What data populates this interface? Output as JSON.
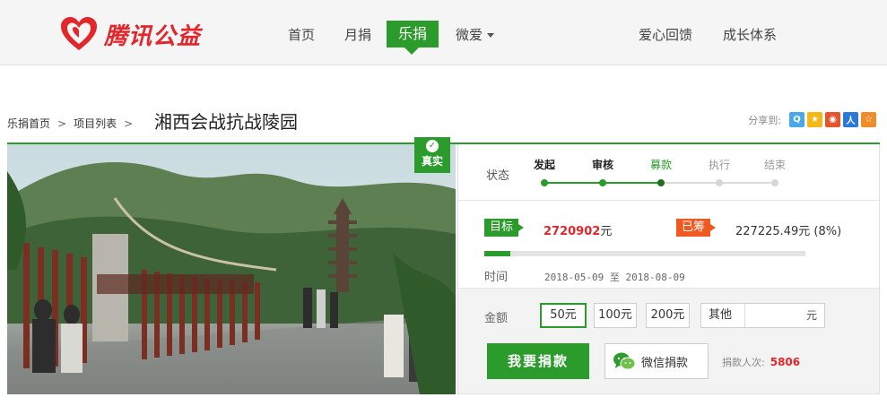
{
  "brand": {
    "name": "腾讯公益"
  },
  "nav": {
    "items": [
      "首页",
      "月捐",
      "乐捐",
      "微爱"
    ],
    "active": "乐捐",
    "right_items": [
      "爱心回馈",
      "成长体系"
    ]
  },
  "breadcrumb": [
    "乐捐首页",
    "项目列表"
  ],
  "breadcrumb_sep": ">",
  "project": {
    "title": "湘西会战抗战陵园"
  },
  "share": {
    "label": "分享到:",
    "icons": [
      "qzone-icon",
      "qq-star-icon",
      "weibo-icon",
      "renren-icon",
      "pengyou-icon"
    ]
  },
  "badge": {
    "label": "真实"
  },
  "status": {
    "label": "状态",
    "steps": [
      {
        "name": "发起",
        "state": "done"
      },
      {
        "name": "审核",
        "state": "done"
      },
      {
        "name": "募款",
        "state": "current"
      },
      {
        "name": "执行",
        "state": "todo"
      },
      {
        "name": "结束",
        "state": "todo"
      }
    ]
  },
  "goal": {
    "tag": "目标",
    "amount": "2720902",
    "unit": "元"
  },
  "raised": {
    "tag": "已筹",
    "text": "227225.49元 (8%)",
    "percent": 8
  },
  "time": {
    "label": "时间",
    "range": "2018-05-09 至 2018-08-09"
  },
  "donate": {
    "amount_label": "金额",
    "options": [
      "50元",
      "100元",
      "200元"
    ],
    "selected": "50元",
    "other_label": "其他",
    "other_unit": "元",
    "donate_button": "我要捐款",
    "wechat_button": "微信捐款",
    "donors_label": "捐款人次:",
    "donors_count": "5806"
  },
  "colors": {
    "brand_red": "#e3262b",
    "green": "#2b9b2b",
    "orange": "#f05a21"
  }
}
